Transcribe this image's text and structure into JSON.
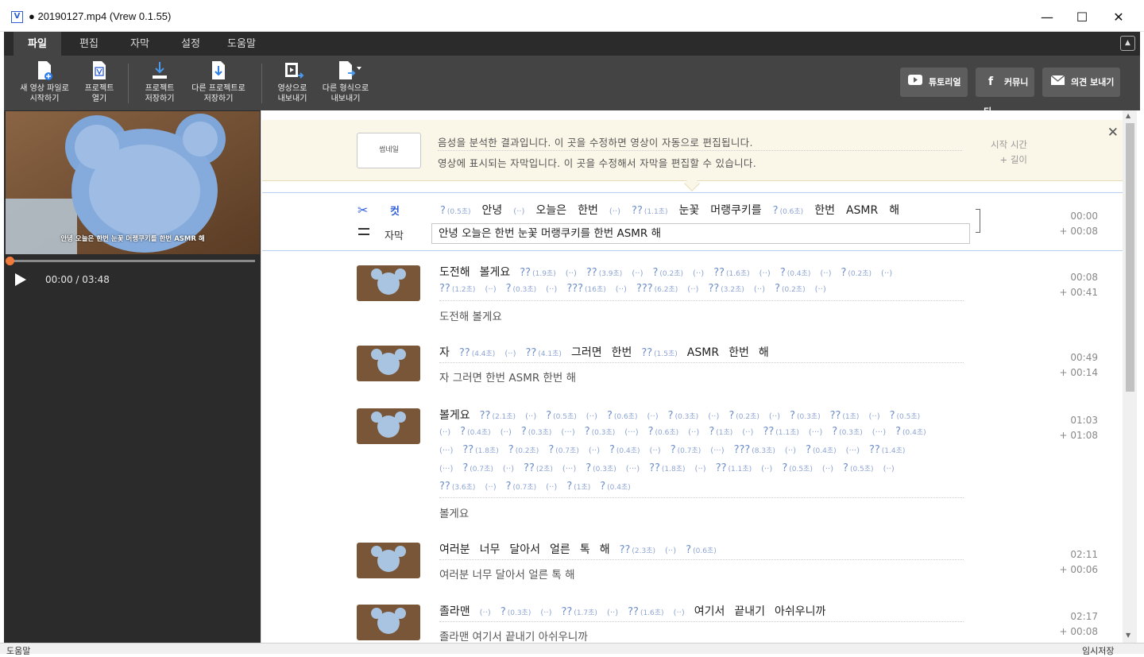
{
  "window": {
    "title": "● 20190127.mp4 (Vrew 0.1.55)",
    "logo": "V",
    "min": "—",
    "max": "☐",
    "close": "✕"
  },
  "menu": [
    "파일",
    "편집",
    "자막",
    "설정",
    "도움말"
  ],
  "toolbar": {
    "tools": [
      {
        "label": "새 영상 파일로\n시작하기",
        "icon": "new-video-icon"
      },
      {
        "label": "프로젝트\n열기",
        "icon": "open-project-icon"
      },
      {
        "label": "프로젝트\n저장하기",
        "icon": "save-project-icon"
      },
      {
        "label": "다른 프로젝트로\n저장하기",
        "icon": "save-as-icon"
      },
      {
        "label": "영상으로\n내보내기",
        "icon": "export-video-icon"
      },
      {
        "label": "다른 형식으로\n내보내기",
        "icon": "export-format-icon"
      }
    ],
    "tutorial": "튜토리얼",
    "community": "커뮤니티",
    "feedback": "의견 보내기"
  },
  "player": {
    "caption": "안녕 오늘은 한번 눈꽃 머랭쿠키를 한번 ASMR 해",
    "time": "00:00 / 03:48",
    "progress": 0
  },
  "notice": {
    "thumb": "썸네일",
    "line1": "음성을 분석한 결과입니다. 이 곳을 수정하면 영상이 자동으로 편집됩니다.",
    "line2": "영상에 표시되는 자막입니다. 이 곳을 수정해서 자막을 편집할 수 있습니다.",
    "start_label": "시작 시간",
    "length_label": "+ 길이"
  },
  "current": {
    "cut_label": "컷",
    "sub_label": "자막",
    "subtitle": "안녕 오늘은 한번 눈꽃 머랭쿠키를 한번 ASMR 해",
    "start": "00:00",
    "length": "+ 00:08"
  },
  "clips": [
    {
      "subtitle": "도전해 볼게요",
      "start": "00:08",
      "length": "+ 00:41"
    },
    {
      "subtitle": "자 그러면 한번 ASMR 한번 해",
      "start": "00:49",
      "length": "+ 00:14"
    },
    {
      "subtitle": "볼게요",
      "start": "01:03",
      "length": "+ 01:08"
    },
    {
      "subtitle": "여러분 너무 달아서 얼른 톡 해",
      "start": "02:11",
      "length": "+ 00:06"
    },
    {
      "subtitle": "졸라맨 여기서 끝내기 아쉬우니까",
      "start": "02:17",
      "length": "+ 00:08"
    }
  ],
  "status": {
    "left": "도움말",
    "right": "임시저장"
  }
}
